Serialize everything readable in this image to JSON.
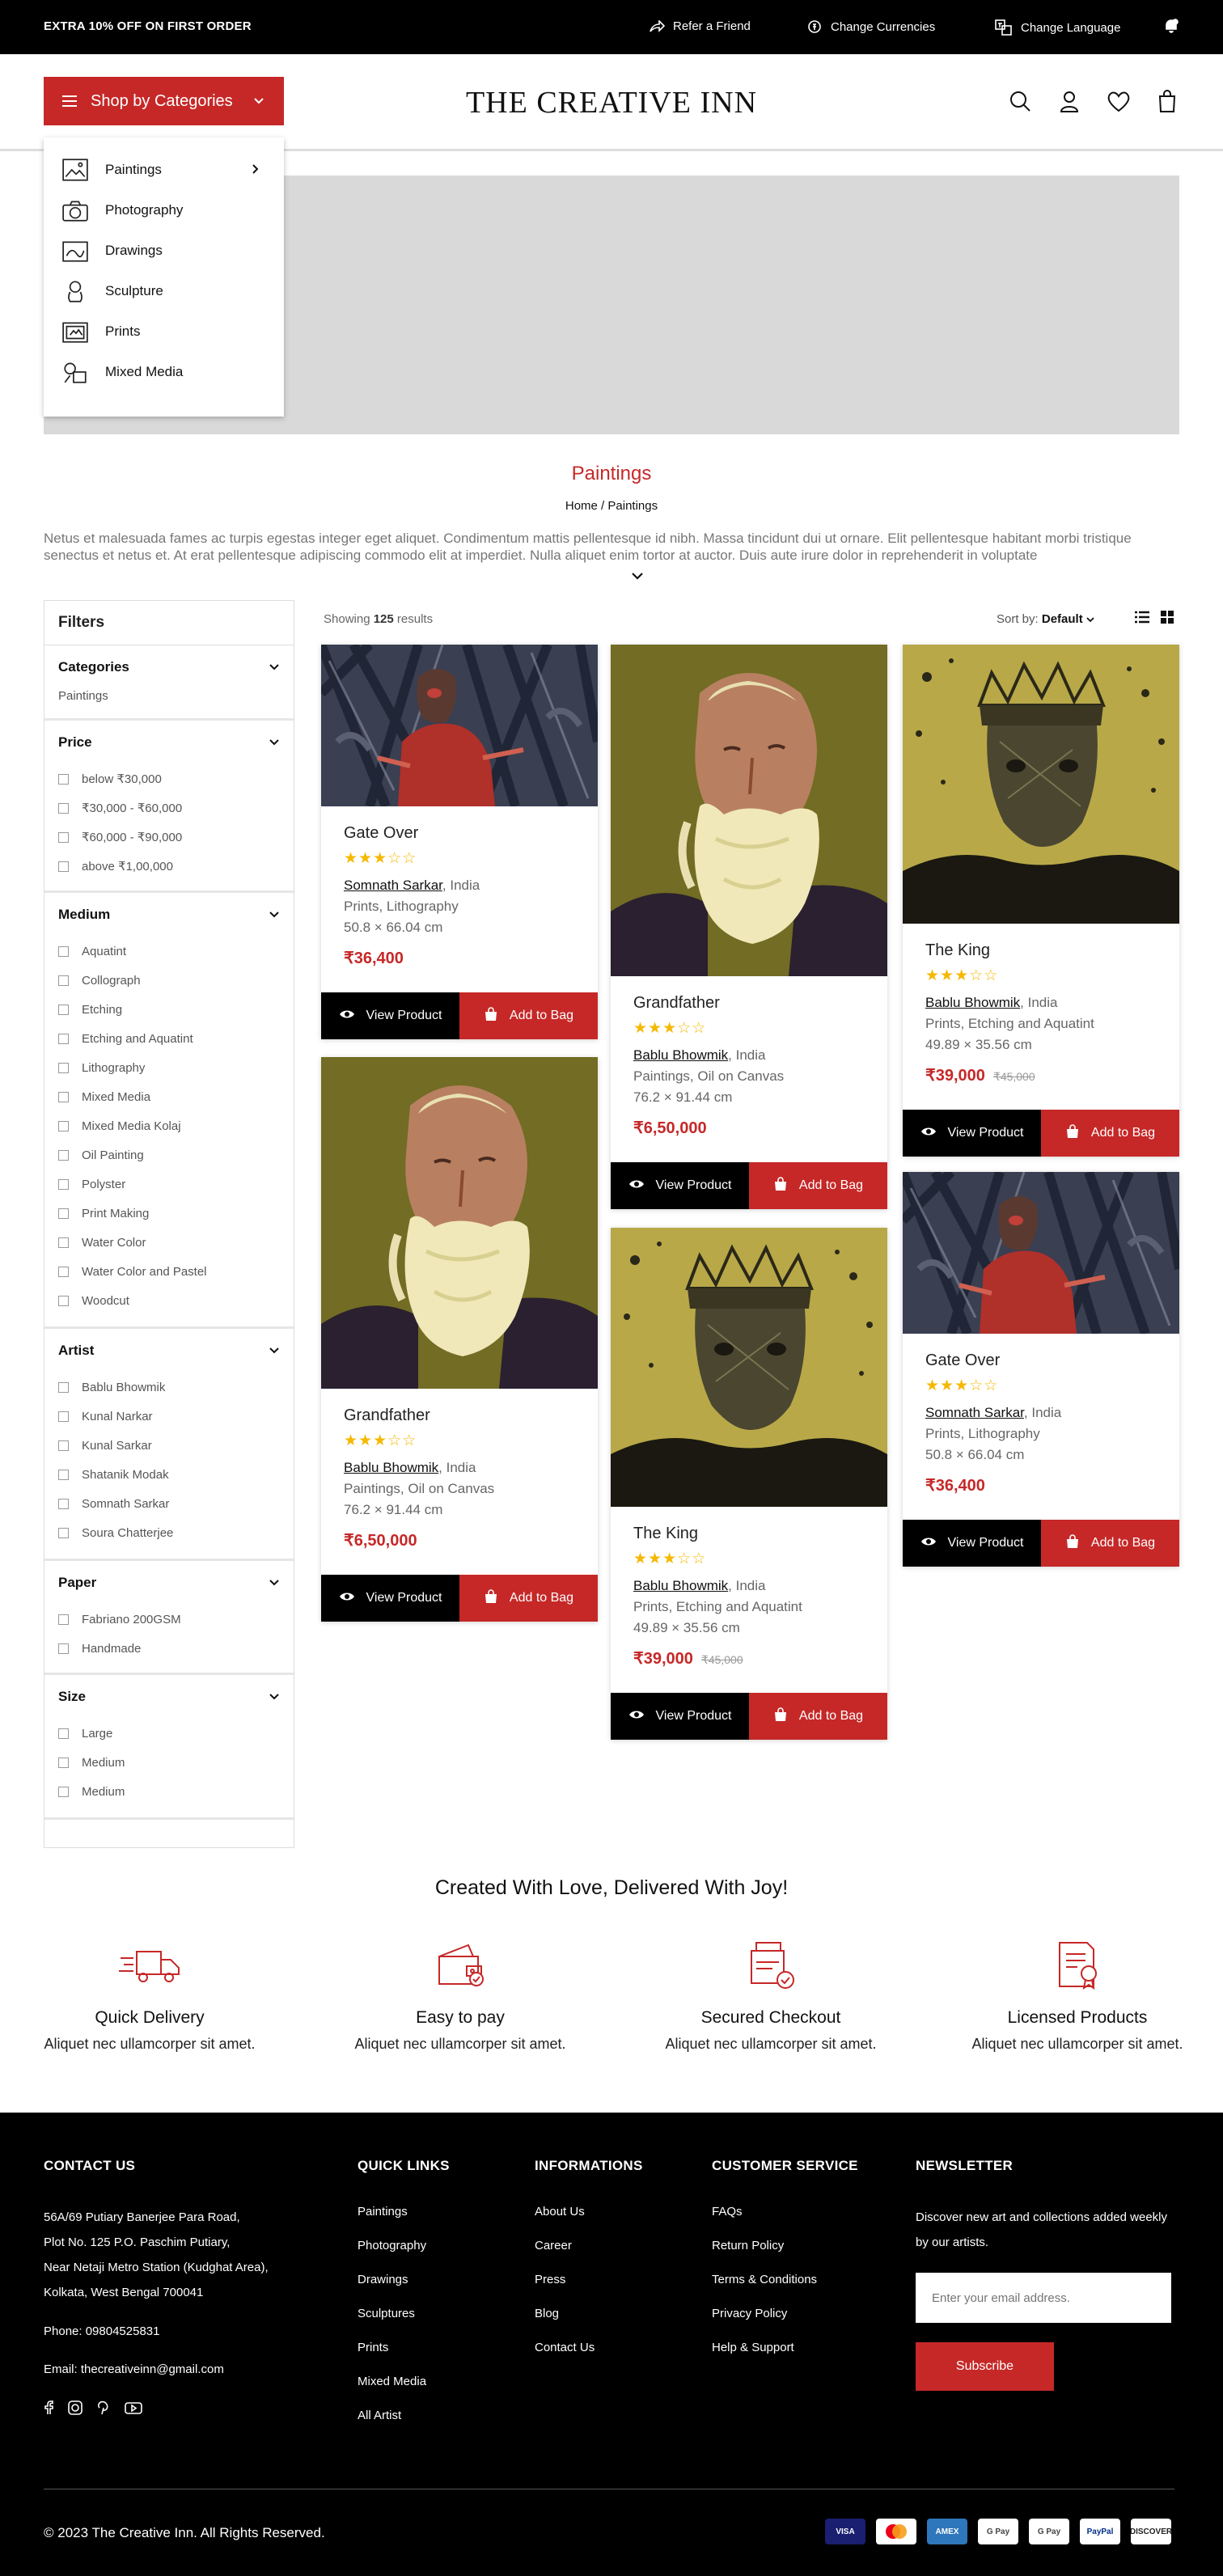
{
  "topbar": {
    "promo": "EXTRA 10% OFF ON FIRST ORDER",
    "refer": "Refer a Friend",
    "currency": "Change Currencies",
    "language": "Change Language"
  },
  "header": {
    "category_button": "Shop by Categories",
    "logo": "THE CREATIVE INN"
  },
  "categories_menu": [
    {
      "label": "Paintings",
      "icon": "painting-icon",
      "has_sub": true
    },
    {
      "label": "Photography",
      "icon": "camera-icon",
      "has_sub": false
    },
    {
      "label": "Drawings",
      "icon": "drawing-icon",
      "has_sub": false
    },
    {
      "label": "Sculpture",
      "icon": "sculpture-icon",
      "has_sub": false
    },
    {
      "label": "Prints",
      "icon": "print-icon",
      "has_sub": false
    },
    {
      "label": "Mixed Media",
      "icon": "mixed-media-icon",
      "has_sub": false
    }
  ],
  "page": {
    "title": "Paintings",
    "breadcrumb": "Home / Paintings",
    "intro": "Netus et malesuada fames ac turpis egestas integer eget aliquet. Condimentum mattis pellentesque id nibh. Massa tincidunt dui ut ornare. Elit pellentesque habitant morbi tristique senectus et netus et. At erat pellentesque adipiscing commodo elit at imperdiet. Nulla aliquet enim tortor at auctor. Duis aute irure dolor in reprehenderit in voluptate"
  },
  "filters": {
    "heading": "Filters",
    "categories": {
      "title": "Categories",
      "value": "Paintings"
    },
    "price": {
      "title": "Price",
      "options": [
        "below ₹30,000",
        "₹30,000 - ₹60,000",
        "₹60,000 - ₹90,000",
        "above ₹1,00,000"
      ]
    },
    "medium": {
      "title": "Medium",
      "options": [
        "Aquatint",
        "Collograph",
        "Etching",
        "Etching and Aquatint",
        "Lithography",
        "Mixed Media",
        "Mixed Media Kolaj",
        "Oil Painting",
        "Polyster",
        "Print Making",
        "Water Color",
        "Water Color and Pastel",
        "Woodcut"
      ]
    },
    "artist": {
      "title": "Artist",
      "options": [
        "Bablu Bhowmik",
        "Kunal Narkar",
        "Kunal Sarkar",
        "Shatanik Modak",
        "Somnath Sarkar",
        "Soura Chatterjee"
      ]
    },
    "paper": {
      "title": "Paper",
      "options": [
        "Fabriano 200GSM",
        "Handmade"
      ]
    },
    "size": {
      "title": "Size",
      "options": [
        "Large",
        "Medium",
        "Medium"
      ]
    }
  },
  "results": {
    "showing_prefix": "Showing",
    "count": "125",
    "showing_suffix": "results",
    "sort_label": "Sort by:",
    "sort_value": "Default"
  },
  "buttons": {
    "view": "View Product",
    "bag": "Add to Bag"
  },
  "products": [
    {
      "title": "Gate Over",
      "rating": 3,
      "artist": "Somnath Sarkar",
      "country": ", India",
      "medium": "Prints, Lithography",
      "size": "50.8 × 66.04 cm",
      "price": "₹36,400",
      "old_price": "",
      "art": "gate"
    },
    {
      "title": "Grandfather",
      "rating": 3,
      "artist": "Bablu Bhowmik",
      "country": ", India",
      "medium": "Paintings, Oil on Canvas",
      "size": "76.2 × 91.44 cm",
      "price": "₹6,50,000",
      "old_price": "",
      "art": "grand"
    },
    {
      "title": "The King",
      "rating": 3,
      "artist": "Bablu Bhowmik",
      "country": ", India",
      "medium": "Prints, Etching and Aquatint",
      "size": "49.89 × 35.56 cm",
      "price": "₹39,000",
      "old_price": "₹45,000",
      "art": "king"
    },
    {
      "title": "Grandfather",
      "rating": 3,
      "artist": "Bablu Bhowmik",
      "country": ", India",
      "medium": "Paintings, Oil on Canvas",
      "size": "76.2 × 91.44 cm",
      "price": "₹6,50,000",
      "old_price": "",
      "art": "grand"
    },
    {
      "title": "The King",
      "rating": 3,
      "artist": "Bablu Bhowmik",
      "country": ", India",
      "medium": "Prints, Etching and Aquatint",
      "size": "49.89 × 35.56 cm",
      "price": "₹39,000",
      "old_price": "₹45,000",
      "art": "king"
    },
    {
      "title": "Gate Over",
      "rating": 3,
      "artist": "Somnath Sarkar",
      "country": ", India",
      "medium": "Prints, Lithography",
      "size": "50.8 × 66.04 cm",
      "price": "₹36,400",
      "old_price": "",
      "art": "gate"
    }
  ],
  "features": {
    "title": "Created With Love, Delivered With Joy!",
    "items": [
      {
        "title": "Quick Delivery",
        "desc": "Aliquet nec ullamcorper sit amet.",
        "icon": "truck-icon"
      },
      {
        "title": "Easy to pay",
        "desc": "Aliquet nec ullamcorper sit amet.",
        "icon": "wallet-icon"
      },
      {
        "title": "Secured Checkout",
        "desc": "Aliquet nec ullamcorper sit amet.",
        "icon": "secure-card-icon"
      },
      {
        "title": "Licensed Products",
        "desc": "Aliquet nec ullamcorper sit amet.",
        "icon": "certificate-icon"
      }
    ]
  },
  "footer": {
    "contact": {
      "title": "CONTACT US",
      "address": [
        "56A/69 Putiary Banerjee Para Road,",
        "Plot No. 125 P.O. Paschim Putiary,",
        "Near Netaji Metro Station (Kudghat Area),",
        "Kolkata, West Bengal 700041"
      ],
      "phone": "Phone: 09804525831",
      "email": "Email: thecreativeinn@gmail.com"
    },
    "quick_links": {
      "title": "QUICK LINKS",
      "items": [
        "Paintings",
        "Photography",
        "Drawings",
        "Sculptures",
        "Prints",
        "Mixed Media",
        "All Artist"
      ]
    },
    "informations": {
      "title": "INFORMATIONS",
      "items": [
        "About Us",
        "Career",
        "Press",
        "Blog",
        "Contact Us"
      ]
    },
    "customer_service": {
      "title": "CUSTOMER SERVICE",
      "items": [
        "FAQs",
        "Return Policy",
        "Terms & Conditions",
        "Privacy Policy",
        "Help & Support"
      ]
    },
    "newsletter": {
      "title": "NEWSLETTER",
      "text": "Discover new art and collections added weekly by our artists.",
      "placeholder": "Enter your email address.",
      "button": "Subscribe"
    },
    "copyright": "© 2023 The Creative Inn. All Rights Reserved.",
    "payments": [
      "VISA",
      "Mastercard",
      "AMEX",
      "G Pay",
      "G Pay",
      "PayPal",
      "DISCOVER"
    ]
  },
  "colors": {
    "accent": "#c62828",
    "star": "#f5b800"
  }
}
